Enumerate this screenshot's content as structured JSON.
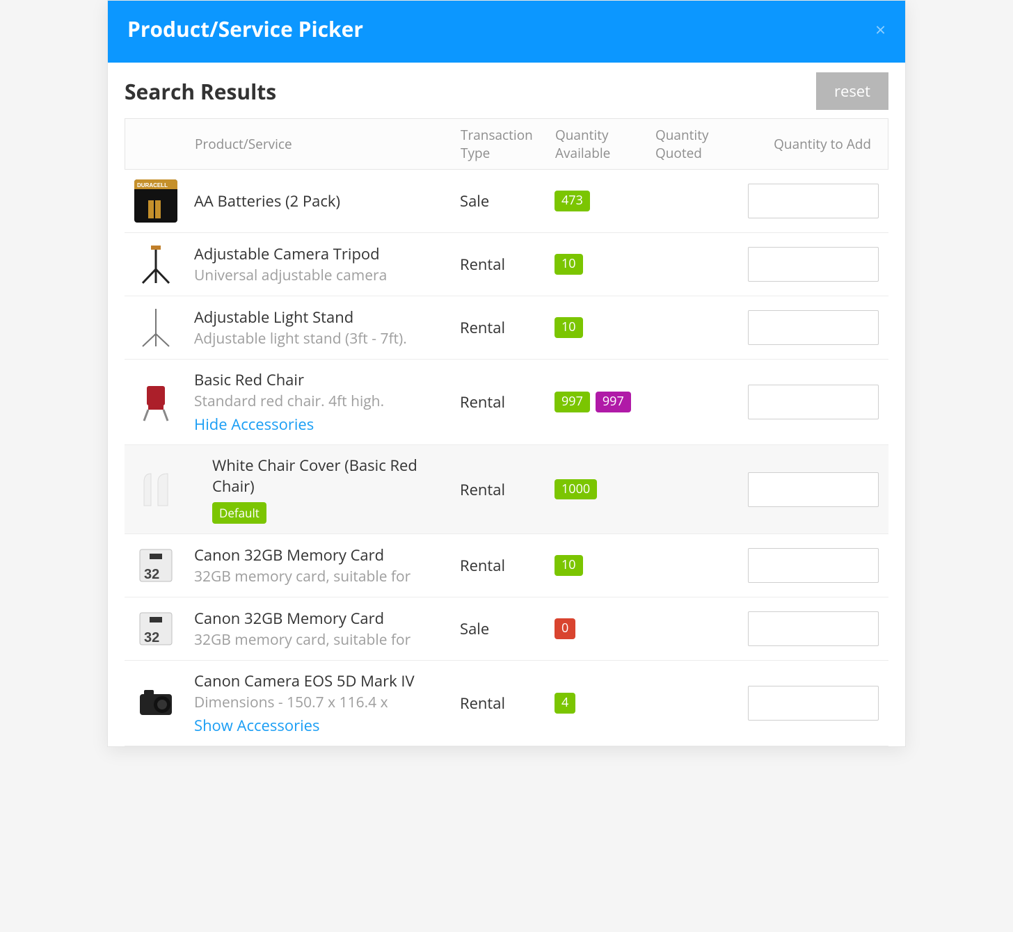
{
  "modal": {
    "title": "Product/Service Picker",
    "close_label": "×"
  },
  "results": {
    "heading": "Search Results",
    "reset_label": "reset"
  },
  "columns": {
    "product": "Product/Service",
    "transaction_type": "Transaction Type",
    "quantity_available": "Quantity Available",
    "quantity_quoted": "Quantity Quoted",
    "quantity_to_add": "Quantity to Add"
  },
  "rows": [
    {
      "id": "aa-batteries",
      "thumb": "batteries",
      "name": "AA Batteries (2 Pack)",
      "subtitle": "",
      "transaction": "Sale",
      "available": "473",
      "available_color": "green",
      "quoted": "",
      "accessory_toggle": "",
      "is_accessory": false,
      "tag": ""
    },
    {
      "id": "tripod",
      "thumb": "tripod",
      "name": "Adjustable Camera Tripod",
      "subtitle": "Universal adjustable camera",
      "transaction": "Rental",
      "available": "10",
      "available_color": "green",
      "quoted": "",
      "accessory_toggle": "",
      "is_accessory": false,
      "tag": ""
    },
    {
      "id": "light-stand",
      "thumb": "lightstand",
      "name": "Adjustable Light Stand",
      "subtitle": "Adjustable light stand (3ft - 7ft).",
      "transaction": "Rental",
      "available": "10",
      "available_color": "green",
      "quoted": "",
      "accessory_toggle": "",
      "is_accessory": false,
      "tag": ""
    },
    {
      "id": "red-chair",
      "thumb": "redchair",
      "name": "Basic Red Chair",
      "subtitle": "Standard red chair. 4ft high.",
      "transaction": "Rental",
      "available": "997",
      "available_color": "green",
      "quoted": "997",
      "quoted_color": "purple",
      "accessory_toggle": "Hide Accessories",
      "is_accessory": false,
      "tag": ""
    },
    {
      "id": "white-cover",
      "thumb": "whitecover",
      "name": "White Chair Cover (Basic Red Chair)",
      "subtitle": "",
      "transaction": "Rental",
      "available": "1000",
      "available_color": "green",
      "quoted": "",
      "accessory_toggle": "",
      "is_accessory": true,
      "tag": "Default"
    },
    {
      "id": "canon-32gb-rental",
      "thumb": "sdcard",
      "name": "Canon 32GB Memory Card",
      "subtitle": "32GB memory card, suitable for",
      "transaction": "Rental",
      "available": "10",
      "available_color": "green",
      "quoted": "",
      "accessory_toggle": "",
      "is_accessory": false,
      "tag": ""
    },
    {
      "id": "canon-32gb-sale",
      "thumb": "sdcard",
      "name": "Canon 32GB Memory Card",
      "subtitle": "32GB memory card, suitable for",
      "transaction": "Sale",
      "available": "0",
      "available_color": "red",
      "quoted": "",
      "accessory_toggle": "",
      "is_accessory": false,
      "tag": ""
    },
    {
      "id": "canon-5d",
      "thumb": "camera",
      "name": "Canon Camera EOS 5D Mark IV",
      "subtitle": "Dimensions - 150.7 x 116.4 x",
      "transaction": "Rental",
      "available": "4",
      "available_color": "green",
      "quoted": "",
      "accessory_toggle": "Show Accessories",
      "is_accessory": false,
      "tag": ""
    }
  ]
}
